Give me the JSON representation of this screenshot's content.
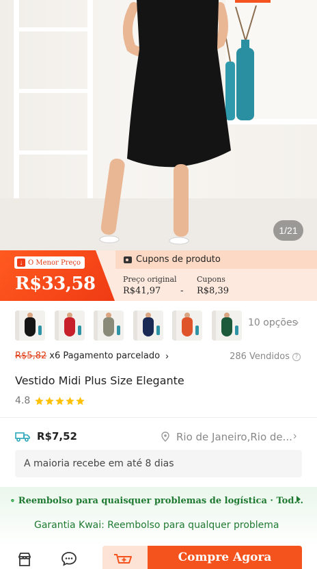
{
  "product_image": {
    "counter": "1/21"
  },
  "price": {
    "lowest_badge": "O Menor Preço",
    "current": "R$33,58",
    "coupon_header": "Cupons de produto",
    "original_label": "Preço original",
    "original_value": "R$41,97",
    "minus": "-",
    "coupon_label": "Cupons",
    "coupon_value": "R$8,39"
  },
  "variants": {
    "colors": [
      "#151515",
      "#c8202a",
      "#8a8a78",
      "#1b2a55",
      "#e0542b",
      "#1d5a3b"
    ],
    "options_label": "10 opções"
  },
  "installment": {
    "strike_price": "R$5,82",
    "text": "x6 Pagamento parcelado",
    "sold": "286 Vendidos"
  },
  "product": {
    "title": "Vestido Midi Plus Size Elegante",
    "rating": "4.8",
    "stars": 5
  },
  "shipping": {
    "price": "R$7,52",
    "location": "Rio de Janeiro,Rio de...",
    "delivery_note": "A maioria recebe em até 8 dias"
  },
  "guarantee": {
    "refund_text": "Reembolso para quaisquer problemas de logística · Tod...",
    "kwai_text": "Garantia Kwai: Reembolso para qualquer problema"
  },
  "bottom_bar": {
    "buy_label": "Compre Agora"
  },
  "colors": {
    "accent_orange": "#f5531e",
    "guarantee_green": "#1f7a32",
    "star_yellow": "#ffc107"
  }
}
